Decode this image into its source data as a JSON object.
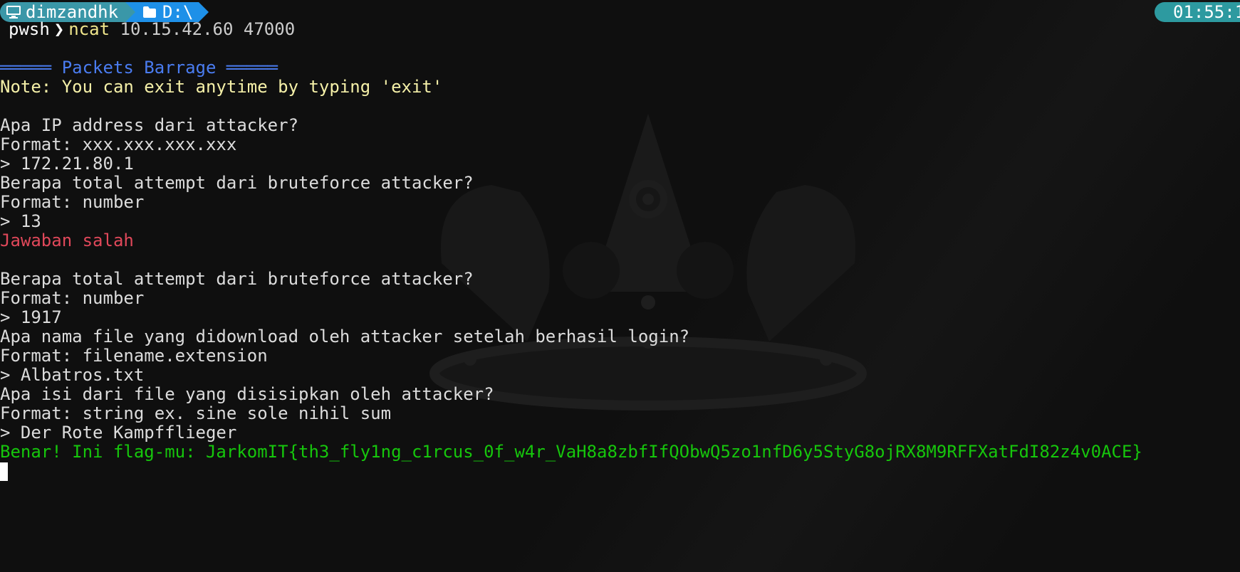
{
  "prompt": {
    "user": "dimzandhk",
    "path": "D:\\",
    "time": "01:55:1",
    "shell": "pwsh",
    "command": "ncat",
    "command_args": "10.15.42.60 47000",
    "user_icon": "monitor-icon",
    "path_icon": "folder-icon"
  },
  "output": {
    "banner": "═════ Packets Barrage ═════",
    "note": "Note: You can exit anytime by typing 'exit'",
    "q1": "Apa IP address dari attacker?",
    "q1_format": "Format: xxx.xxx.xxx.xxx",
    "a1": "> 172.21.80.1",
    "q2": "Berapa total attempt dari bruteforce attacker?",
    "q2_format": "Format: number",
    "a2": "> 13",
    "wrong": "Jawaban salah",
    "q2b": "Berapa total attempt dari bruteforce attacker?",
    "q2b_format": "Format: number",
    "a2b": "> 1917",
    "q3": "Apa nama file yang didownload oleh attacker setelah berhasil login?",
    "q3_format": "Format: filename.extension",
    "a3": "> Albatros.txt",
    "q4": "Apa isi dari file yang disisipkan oleh attacker?",
    "q4_format": "Format: string ex. sine sole nihil sum",
    "a4": "> Der Rote Kampfflieger",
    "flag": "Benar! Ini flag-mu: JarkomIT{th3_fly1ng_c1rcus_0f_w4r_VaH8a8zbfIfQObwQ5zo1nfD6y5StyG8ojRX8M9RFFXatFdI82z4v0ACE}"
  },
  "colors": {
    "background": "#0f0f0f",
    "user_segment": "#3a97a8",
    "path_segment": "#1e90e8",
    "time_segment": "#2d9aa0",
    "banner": "#4a7cf0",
    "note": "#f5f0a8",
    "error": "#e0485a",
    "success": "#16c60c"
  }
}
